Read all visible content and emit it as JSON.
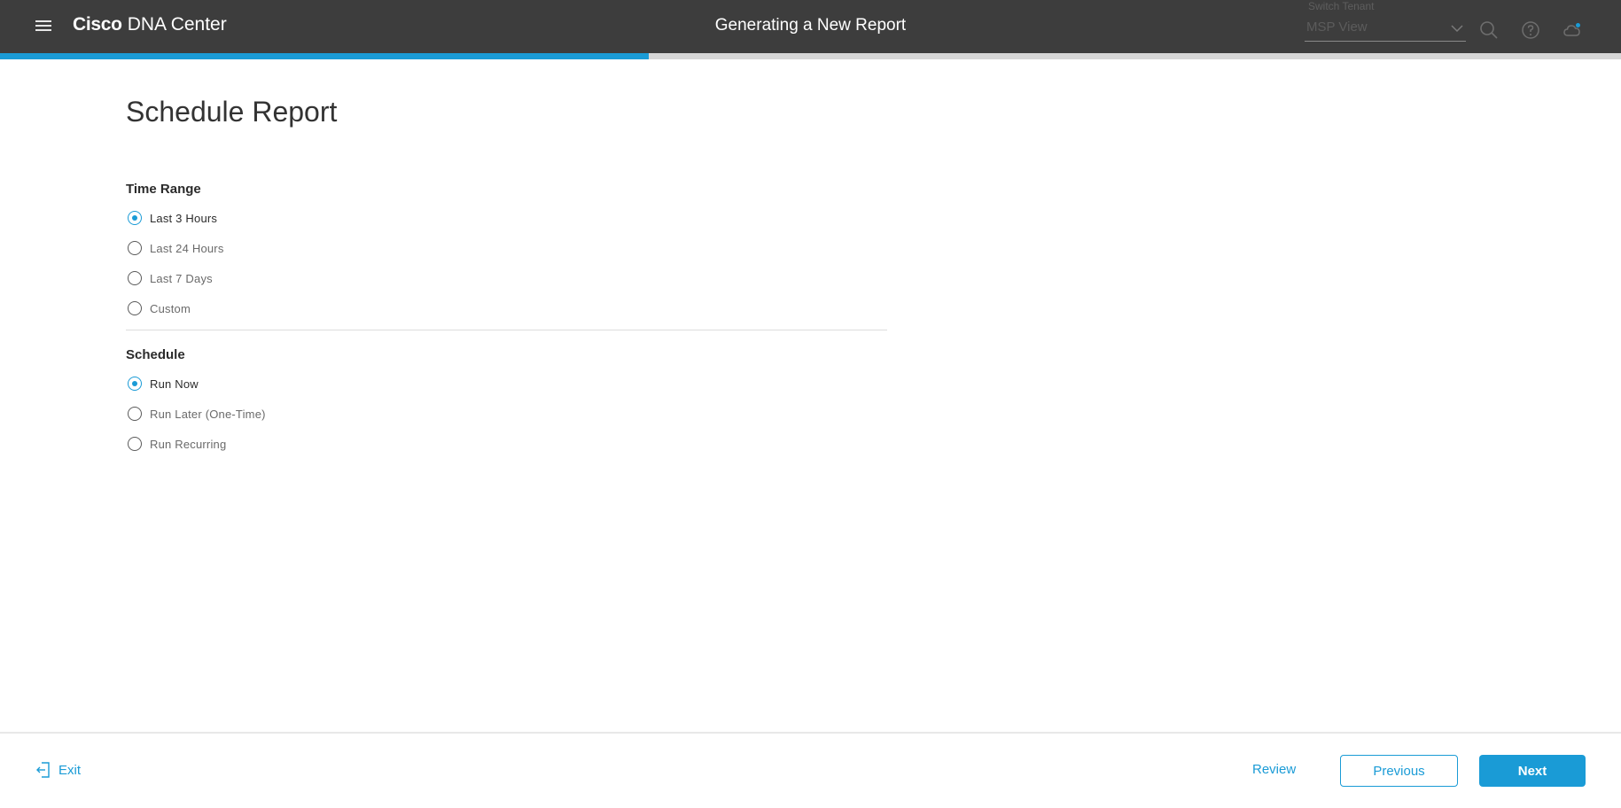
{
  "header": {
    "brand_bold": "Cisco",
    "brand_rest": "DNA Center",
    "page_heading": "Generating a New Report",
    "tenant": {
      "label": "Switch Tenant",
      "value": "MSP View"
    },
    "icons": [
      "menu-icon",
      "chevron-down-icon",
      "search-icon",
      "help-icon",
      "cloud-notification-icon"
    ]
  },
  "progress": {
    "percent": 40
  },
  "main": {
    "title": "Schedule Report",
    "time_range": {
      "title": "Time Range",
      "options": [
        "Last 3 Hours",
        "Last 24 Hours",
        "Last 7 Days",
        "Custom"
      ],
      "selected": "Last 3 Hours"
    },
    "schedule": {
      "title": "Schedule",
      "options": [
        "Run Now",
        "Run Later (One-Time)",
        "Run Recurring"
      ],
      "selected": "Run Now"
    }
  },
  "footer": {
    "exit_label": "Exit",
    "review_label": "Review",
    "previous_label": "Previous",
    "next_label": "Next"
  },
  "colors": {
    "accent": "#1a9bd6",
    "topbar": "#3d3d3d"
  }
}
